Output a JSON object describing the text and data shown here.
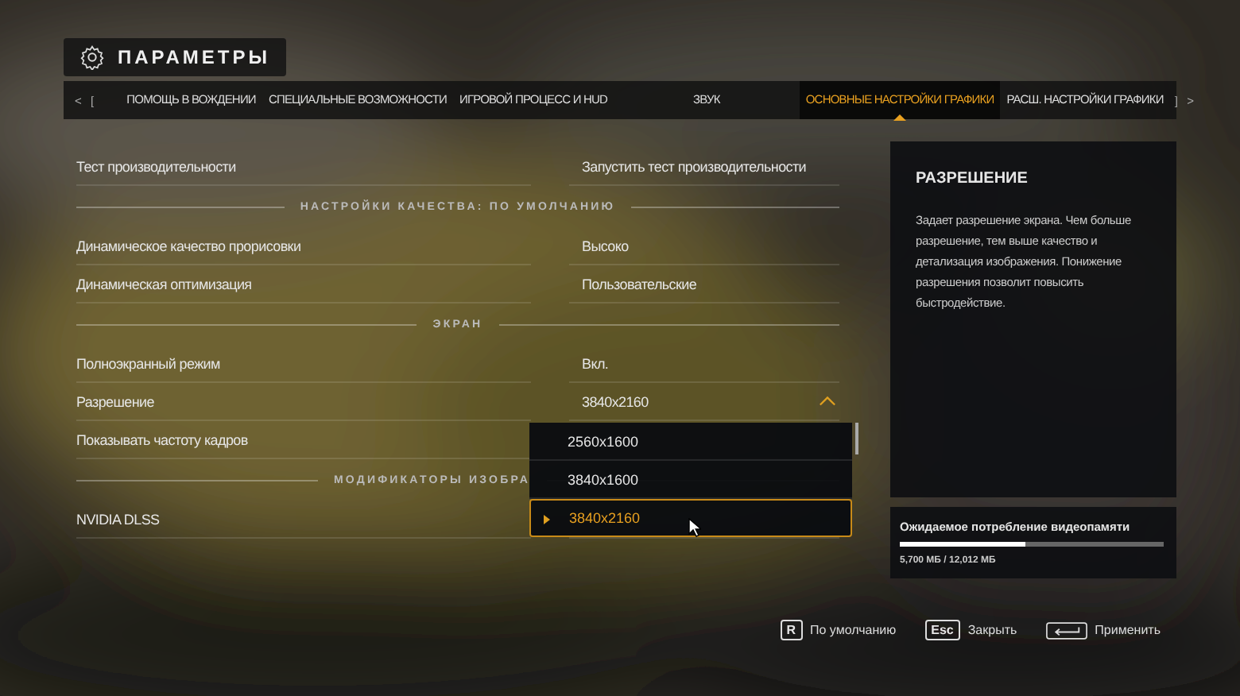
{
  "header": {
    "title": "ПАРАМЕТРЫ"
  },
  "tab_bar": {
    "prev": "<",
    "prev_key": "[",
    "next_key": "]",
    "next": ">",
    "tabs": [
      {
        "label": "ПОМОЩЬ В ВОЖДЕНИИ",
        "selected": false
      },
      {
        "label": "СПЕЦИАЛЬНЫЕ ВОЗМОЖНОСТИ",
        "selected": false
      },
      {
        "label": "ИГРОВОЙ ПРОЦЕСС И HUD",
        "selected": false
      },
      {
        "label": "ЗВУК",
        "selected": false
      },
      {
        "label": "ОСНОВНЫЕ НАСТРОЙКИ ГРАФИКИ",
        "selected": true
      },
      {
        "label": "РАСШ. НАСТРОЙКИ ГРАФИКИ",
        "selected": false
      }
    ]
  },
  "settings": [
    {
      "kind": "row",
      "label": "Тест производительности",
      "value": "Запустить тест производительности"
    },
    {
      "kind": "section",
      "label": "НАСТРОЙКИ КАЧЕСТВА: ПО УМОЛЧАНИЮ"
    },
    {
      "kind": "row",
      "label": "Динамическое качество прорисовки",
      "value": "Высоко"
    },
    {
      "kind": "row",
      "label": "Динамическая оптимизация",
      "value": "Пользовательские"
    },
    {
      "kind": "section",
      "label": "ЭКРАН"
    },
    {
      "kind": "row",
      "label": "Полноэкранный режим",
      "value": "Вкл."
    },
    {
      "kind": "dropdown",
      "label": "Разрешение",
      "value": "3840x2160",
      "expanded": true
    },
    {
      "kind": "row",
      "label": "Показывать частоту кадров"
    },
    {
      "kind": "section",
      "label": "МОДИФИКАТОРЫ ИЗОБРА"
    },
    {
      "kind": "row",
      "label": "NVIDIA DLSS"
    }
  ],
  "dropdown_options": [
    {
      "label": "2560x1600",
      "selected": false
    },
    {
      "label": "3840x1600",
      "selected": false
    },
    {
      "label": "3840x2160",
      "selected": true
    }
  ],
  "info_panel": {
    "title": "РАЗРЕШЕНИЕ",
    "text": "Задает разрешение экрана. Чем больше разрешение, тем выше качество и детализация изображения. Понижение разрешения позволит повысить быстродействие."
  },
  "vram": {
    "label": "Ожидаемое потребление видеопамяти",
    "level": 0.475,
    "reading": "5,700 МБ / 12,012 МБ"
  },
  "footer_hints": [
    {
      "kind": "key",
      "key": "R",
      "label": "По умолчанию"
    },
    {
      "kind": "key",
      "key": "Esc",
      "label": "Закрыть"
    },
    {
      "kind": "enter",
      "label": "Применить"
    }
  ]
}
